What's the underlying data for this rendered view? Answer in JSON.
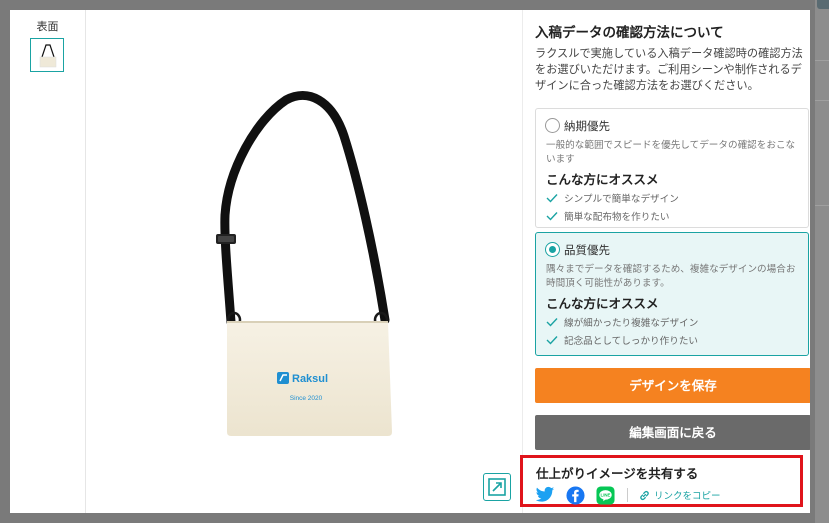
{
  "thumbnails": {
    "label": "表面"
  },
  "panel": {
    "title": "入稿データの確認方法について",
    "description": "ラクスルで実施している入稿データ確認時の確認方法をお選びいただけます。ご利用シーンや制作されるデザインに合った確認方法をお選びください。",
    "options": [
      {
        "title": "納期優先",
        "description": "一般的な範囲でスピードを優先してデータの確認をおこないます",
        "recommend_heading": "こんな方にオススメ",
        "items": [
          "シンプルで簡単なデザイン",
          "簡単な配布物を作りたい"
        ],
        "selected": false
      },
      {
        "title": "品質優先",
        "description": "隅々までデータを確認するため、複雑なデザインの場合お時間頂く可能性があります。",
        "recommend_heading": "こんな方にオススメ",
        "items": [
          "線が細かったり複雑なデザイン",
          "記念品としてしっかり作りたい"
        ],
        "selected": true
      }
    ],
    "save_button": "デザインを保存",
    "back_button": "編集画面に戻る"
  },
  "share": {
    "title": "仕上がりイメージを共有する",
    "twitter_icon": "twitter-icon",
    "facebook_icon": "facebook-icon",
    "line_icon": "line-icon",
    "copy_link": "リンクをコピー"
  },
  "product": {
    "brand": "Raksul",
    "tagline": "Since 2020"
  },
  "colors": {
    "accent": "#1aa3a3",
    "primary_button": "#f58220",
    "secondary_button": "#6a6a6a",
    "highlight_border": "#e0141b",
    "brand_blue": "#1f8fd1"
  }
}
